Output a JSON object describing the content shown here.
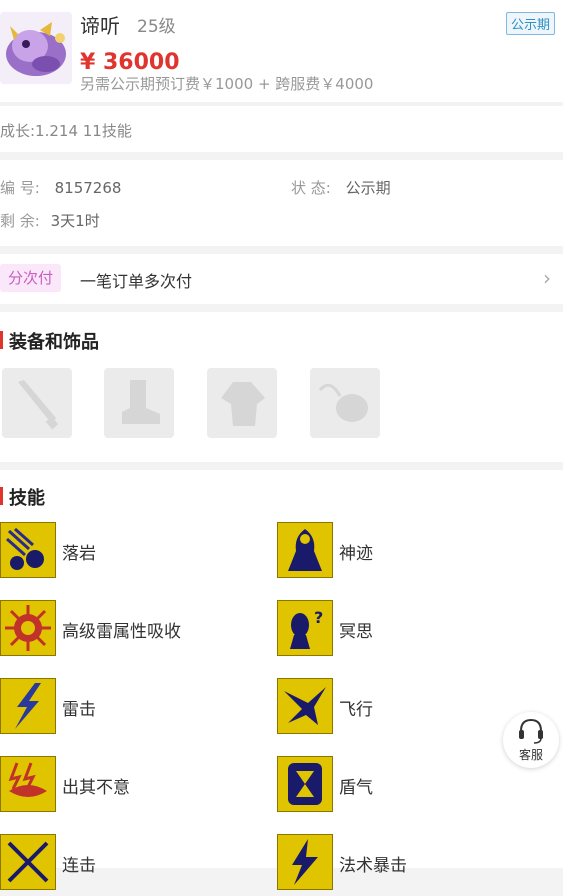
{
  "header": {
    "name": "谛听",
    "level": "25级",
    "price": "¥ 36000",
    "extra_fee": "另需公示期预订费￥1000 + 跨服费￥4000",
    "status_badge": "公示期"
  },
  "growth": {
    "text": "成长:1.214 11技能"
  },
  "info": {
    "id_label": "编 号:",
    "id_value": "8157268",
    "status_label": "状 态:",
    "status_value": "公示期",
    "remain_label": "剩 余:",
    "remain_value": "3天1时"
  },
  "payment": {
    "tag": "分次付",
    "text": "一笔订单多次付",
    "arrow": "›"
  },
  "equipment": {
    "title": "装备和饰品",
    "slots": [
      {
        "icon": "weapon-icon"
      },
      {
        "icon": "boots-icon"
      },
      {
        "icon": "armor-icon"
      },
      {
        "icon": "necklace-icon"
      }
    ]
  },
  "skills": {
    "title": "技能",
    "items": [
      {
        "name": "落岩",
        "icon": "falling-rock-icon"
      },
      {
        "name": "神迹",
        "icon": "miracle-icon"
      },
      {
        "name": "高级雷属性吸收",
        "icon": "thunder-absorb-icon"
      },
      {
        "name": "冥思",
        "icon": "meditation-icon"
      },
      {
        "name": "雷击",
        "icon": "lightning-icon"
      },
      {
        "name": "飞行",
        "icon": "flight-icon"
      },
      {
        "name": "出其不意",
        "icon": "surprise-icon"
      },
      {
        "name": "盾气",
        "icon": "shield-qi-icon"
      },
      {
        "name": "连击",
        "icon": "combo-icon"
      },
      {
        "name": "法术暴击",
        "icon": "spell-crit-icon"
      }
    ]
  },
  "customer_service": {
    "label": "客服"
  },
  "colors": {
    "price": "#e0342e",
    "accent_bar": "#e0342e",
    "skill_bg": "#e0c400",
    "badge": "#2e8fc5"
  }
}
